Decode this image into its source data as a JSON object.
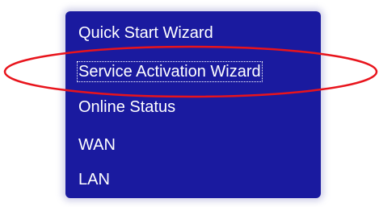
{
  "menu": {
    "items": [
      {
        "label": "Quick Start Wizard"
      },
      {
        "label": "Service Activation Wizard",
        "selected": true
      },
      {
        "label": "Online Status"
      },
      {
        "label": "WAN"
      },
      {
        "label": "LAN"
      }
    ]
  },
  "colors": {
    "menu_background": "#1a1a9f",
    "menu_text": "#ffffff",
    "highlight_ellipse": "#e8141c"
  }
}
